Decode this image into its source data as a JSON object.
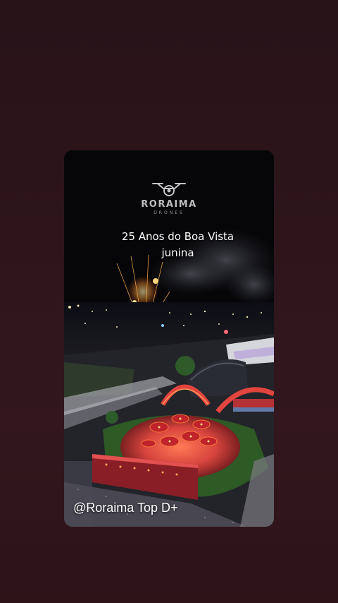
{
  "story": {
    "logo_name": "RORAIMA",
    "logo_sub": "DRONES",
    "headline_line1": "25 Anos do Boa Vista",
    "headline_line2": "junina",
    "handle": "@Roraima Top D+"
  },
  "icons": {
    "logo": "drone-icon"
  },
  "colors": {
    "background": "#2e151c",
    "card": "#050507",
    "text": "#ffffff",
    "festival_red": "#d8343a",
    "festival_glow": "#ff8a3a"
  }
}
